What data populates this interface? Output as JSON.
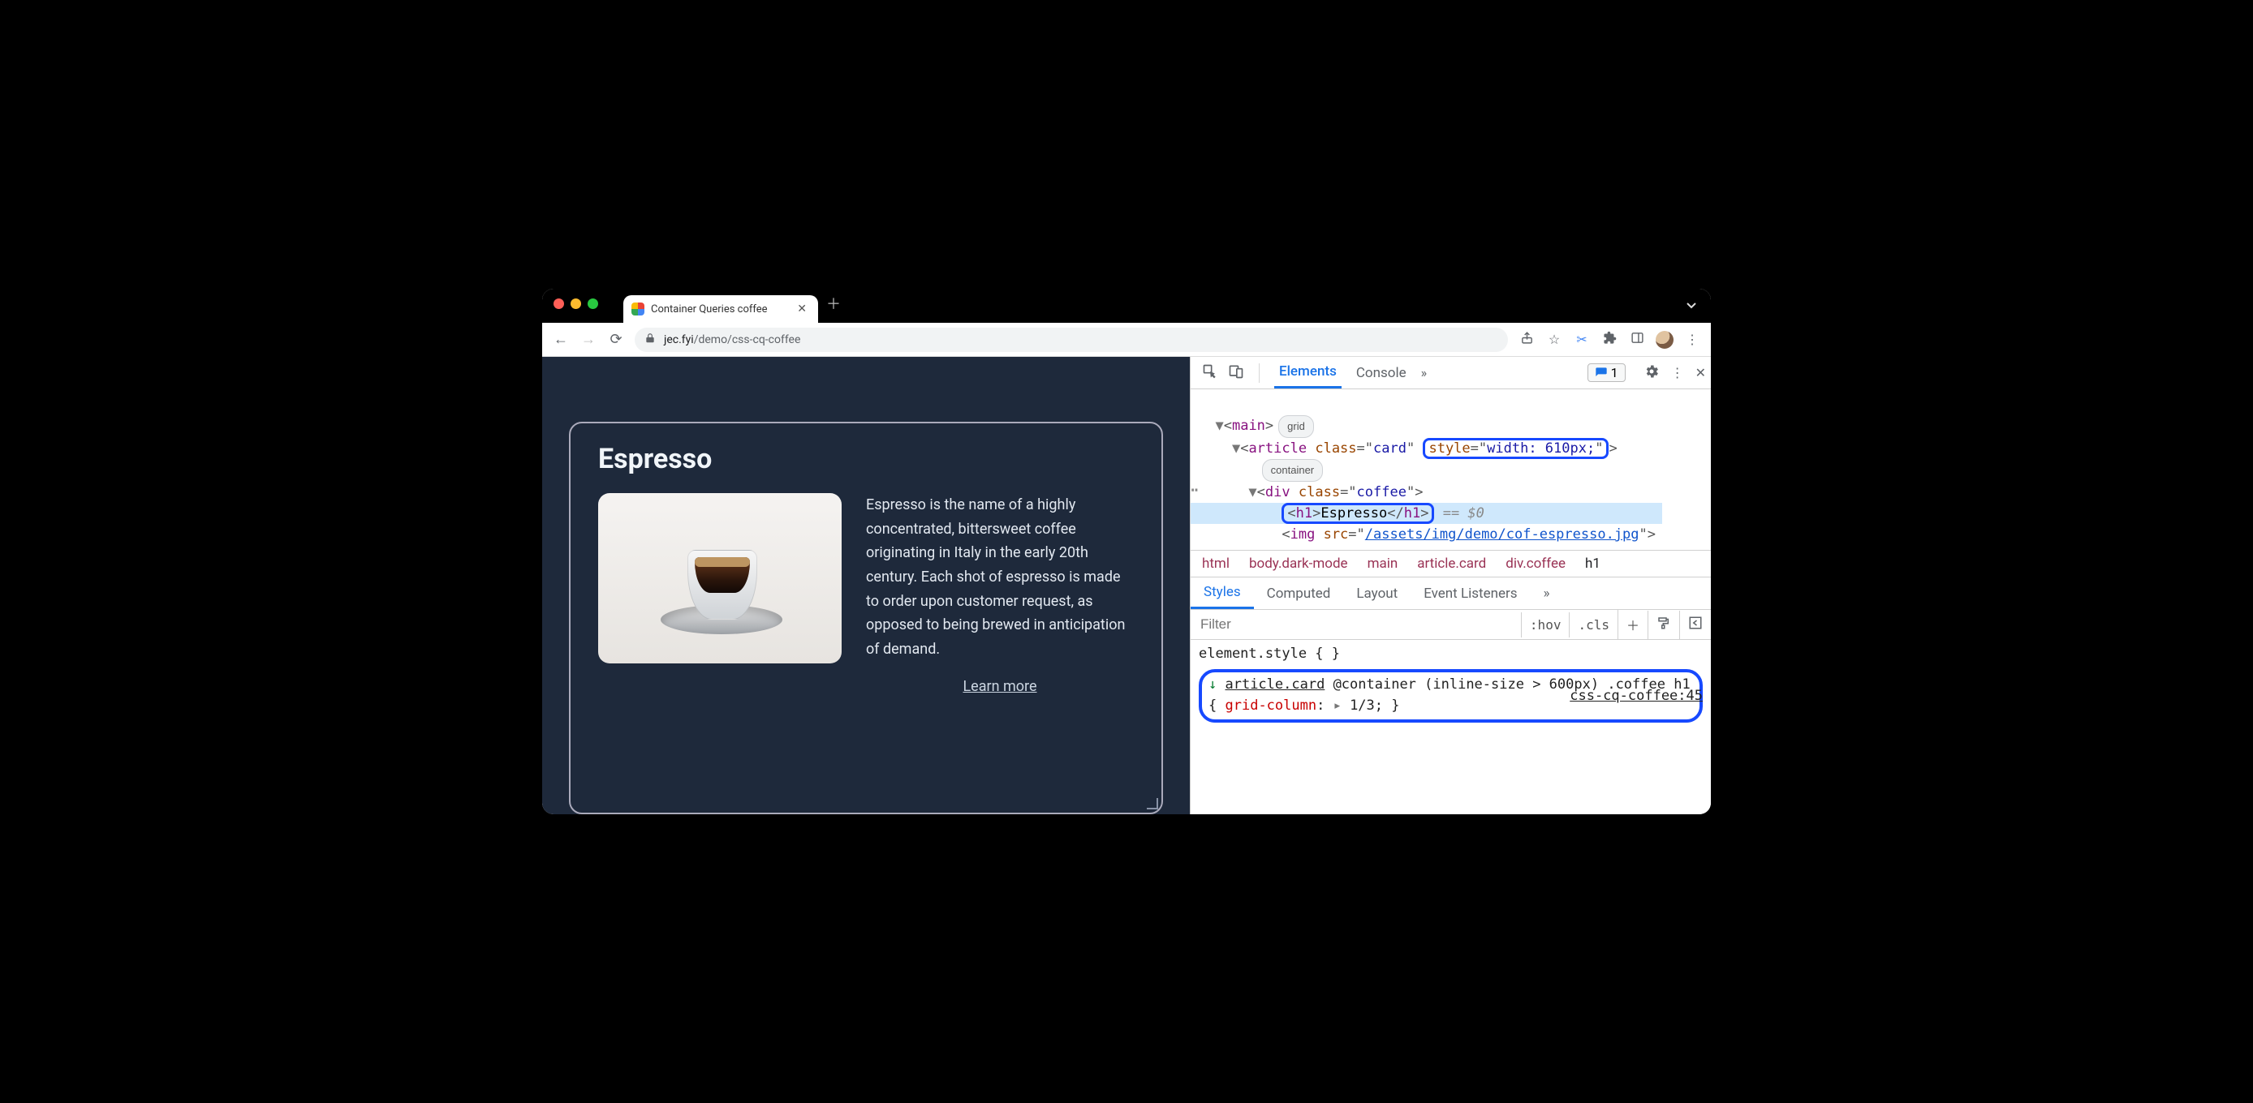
{
  "tab": {
    "title": "Container Queries coffee"
  },
  "urlbar": {
    "lock": "lock-icon",
    "domain": "jec.fyi",
    "path": "/demo/css-cq-coffee"
  },
  "page": {
    "heading": "Espresso",
    "body": "Espresso is the name of a highly concentrated, bittersweet coffee originating in Italy in the early 20th century. Each shot of espresso is made to order upon customer request, as opposed to being brewed in anticipation of demand.",
    "learn_more": "Learn more"
  },
  "devtools": {
    "tabs": {
      "elements": "Elements",
      "console": "Console"
    },
    "issues_count": "1",
    "dom": {
      "main_tag": "main",
      "main_badge": "grid",
      "article_tag": "article",
      "article_class_attr": "class",
      "article_class_val": "card",
      "article_style_attr": "style",
      "article_style_val": "width: 610px;",
      "article_badge": "container",
      "div_tag": "div",
      "div_class_attr": "class",
      "div_class_val": "coffee",
      "h1_open": "<h1>",
      "h1_text": "Espresso",
      "h1_close": "</h1>",
      "h1_eq": "== $0",
      "img_tag": "img",
      "img_src_attr": "src",
      "img_src_val": "/assets/img/demo/cof-espresso.jpg"
    },
    "crumbs": [
      "html",
      "body.dark-mode",
      "main",
      "article.card",
      "div.coffee",
      "h1"
    ],
    "subtabs": {
      "styles": "Styles",
      "computed": "Computed",
      "layout": "Layout",
      "listeners": "Event Listeners"
    },
    "filter_placeholder": "Filter",
    "hov": ":hov",
    "cls": ".cls",
    "styles": {
      "element_style": "element.style {",
      "brace_close": "}",
      "ancestor_prefix": "↓ ",
      "ancestor": "article.card",
      "container_query": "@container (inline-size > 600px)",
      "selector": ".coffee h1 {",
      "prop": "grid-column",
      "val": "1/3",
      "link": "css-cq-coffee:45"
    }
  }
}
